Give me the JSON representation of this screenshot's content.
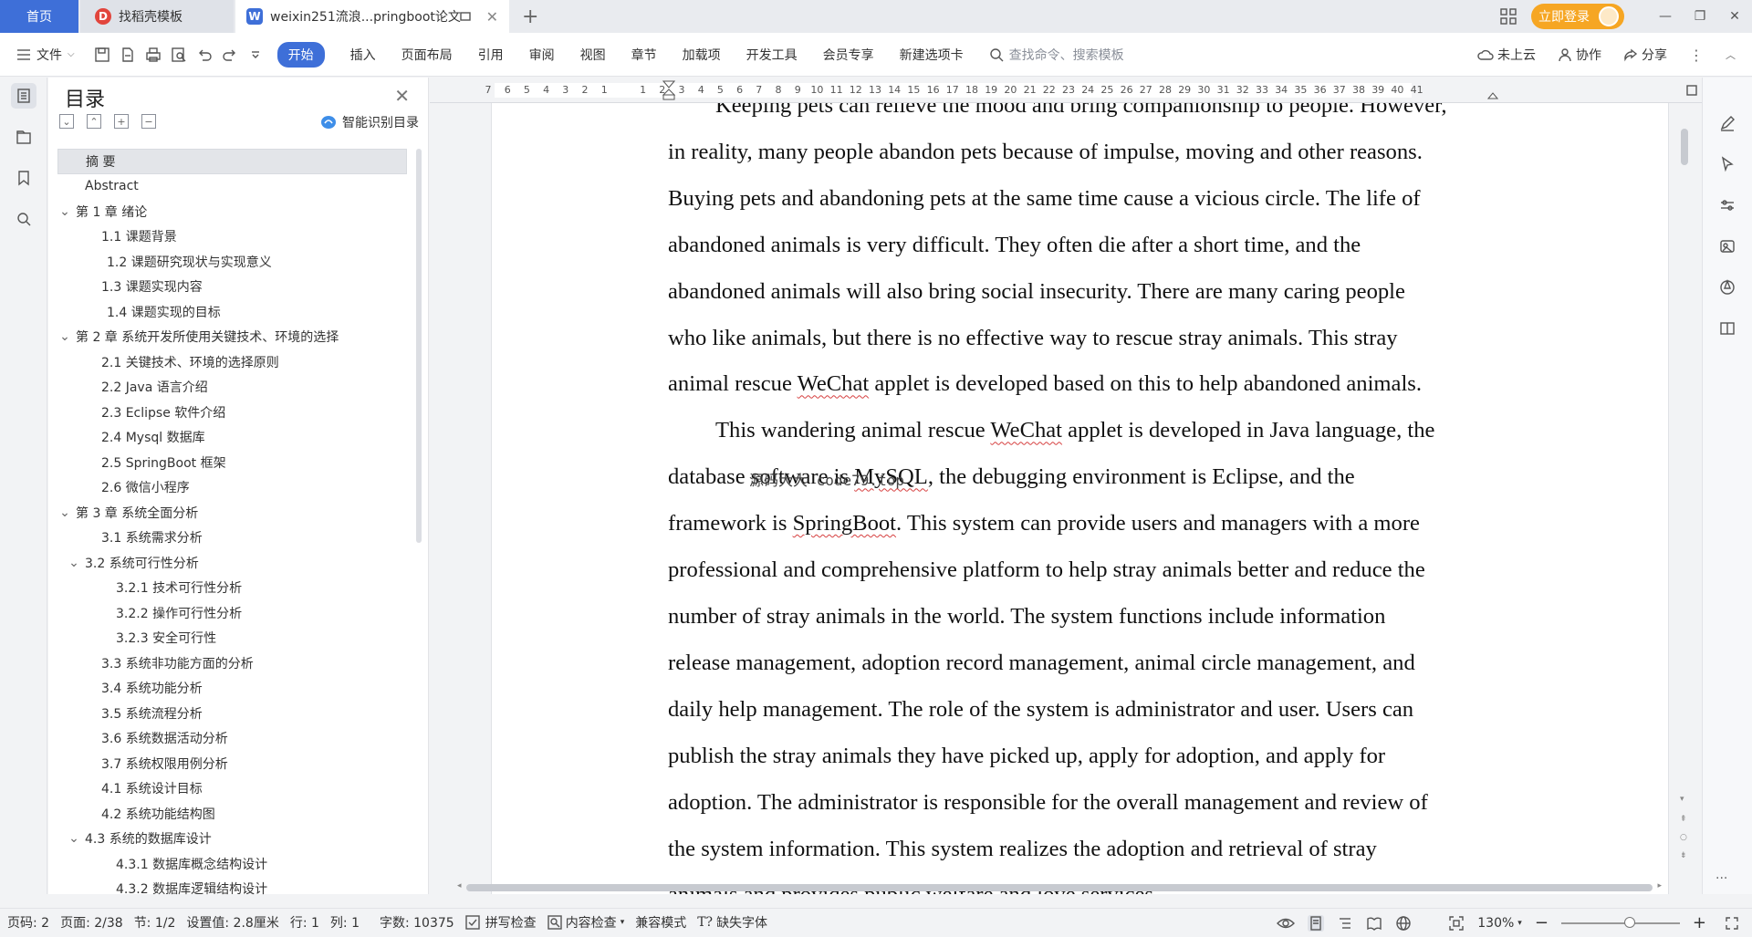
{
  "titlebar": {
    "tabs": [
      {
        "label": "首页"
      },
      {
        "label": "找稻壳模板"
      },
      {
        "label": "weixin251流浪...pringboot论文"
      }
    ],
    "login_label": "立即登录"
  },
  "ribbon": {
    "file_label": "文件",
    "tabs": [
      "开始",
      "插入",
      "页面布局",
      "引用",
      "审阅",
      "视图",
      "章节",
      "加载项",
      "开发工具",
      "会员专享",
      "新建选项卡"
    ],
    "search_placeholder": "查找命令、搜索模板",
    "right": {
      "cloud": "未上云",
      "collab": "协作",
      "share": "分享"
    }
  },
  "toc": {
    "title": "目录",
    "smart_label": "智能识别目录",
    "items": [
      {
        "label": "摘  要",
        "level": 1,
        "chevron": false,
        "selected": true
      },
      {
        "label": "Abstract",
        "level": 1,
        "chevron": false
      },
      {
        "label": "第 1 章  绪论",
        "level": 0,
        "chevron": true
      },
      {
        "label": "1.1 课题背景",
        "level": 2,
        "chevron": false
      },
      {
        "label": "1.2 课题研究现状与实现意义",
        "level": 2,
        "chevron": false,
        "extra": 1
      },
      {
        "label": "1.3 课题实现内容",
        "level": 2,
        "chevron": false
      },
      {
        "label": "1.4 课题实现的目标",
        "level": 2,
        "chevron": false,
        "extra": 1
      },
      {
        "label": "第 2 章  系统开发所使用关键技术、环境的选择",
        "level": 0,
        "chevron": true
      },
      {
        "label": "2.1 关键技术、环境的选择原则",
        "level": 2,
        "chevron": false
      },
      {
        "label": "2.2 Java 语言介绍",
        "level": 2,
        "chevron": false
      },
      {
        "label": "2.3 Eclipse 软件介绍",
        "level": 2,
        "chevron": false
      },
      {
        "label": "2.4 Mysql 数据库",
        "level": 2,
        "chevron": false
      },
      {
        "label": "2.5 SpringBoot 框架",
        "level": 2,
        "chevron": false
      },
      {
        "label": "2.6 微信小程序",
        "level": 2,
        "chevron": false
      },
      {
        "label": "第 3 章  系统全面分析",
        "level": 0,
        "chevron": true
      },
      {
        "label": "3.1 系统需求分析",
        "level": 2,
        "chevron": false
      },
      {
        "label": "3.2 系统可行性分析",
        "level": 1,
        "chevron": true
      },
      {
        "label": "3.2.1 技术可行性分析",
        "level": 3,
        "chevron": false
      },
      {
        "label": "3.2.2 操作可行性分析",
        "level": 3,
        "chevron": false
      },
      {
        "label": "3.2.3 安全可行性",
        "level": 3,
        "chevron": false
      },
      {
        "label": "3.3 系统非功能方面的分析",
        "level": 2,
        "chevron": false
      },
      {
        "label": "3.4 系统功能分析",
        "level": 2,
        "chevron": false
      },
      {
        "label": "3.5 系统流程分析",
        "level": 2,
        "chevron": false
      },
      {
        "label": "3.6 系统数据活动分析",
        "level": 2,
        "chevron": false
      },
      {
        "label": "3.7 系统权限用例分析",
        "level": 2,
        "chevron": false
      },
      {
        "label": "4.1 系统设计目标",
        "level": 2,
        "chevron": false
      },
      {
        "label": "4.2 系统功能结构图",
        "level": 2,
        "chevron": false
      },
      {
        "label": "4.3 系统的数据库设计",
        "level": 1,
        "chevron": true
      },
      {
        "label": "4.3.1 数据库概念结构设计",
        "level": 3,
        "chevron": false
      },
      {
        "label": "4.3.2 数据库逻辑结构设计",
        "level": 3,
        "chevron": false
      }
    ]
  },
  "ruler": {
    "labels": [
      "7",
      "6",
      "5",
      "4",
      "3",
      "2",
      "1",
      "",
      "1",
      "2",
      "3",
      "4",
      "5",
      "6",
      "7",
      "8",
      "9",
      "10",
      "11",
      "12",
      "13",
      "14",
      "15",
      "16",
      "17",
      "18",
      "19",
      "20",
      "21",
      "22",
      "23",
      "24",
      "25",
      "26",
      "27",
      "28",
      "29",
      "30",
      "31",
      "32",
      "33",
      "34",
      "35",
      "36",
      "37",
      "38",
      "39",
      "40",
      "41"
    ]
  },
  "document": {
    "lines": [
      {
        "segments": [
          {
            "text": "Keeping pets can relieve the mood and bring companionship to people. However,"
          }
        ],
        "indent": true
      },
      {
        "segments": [
          {
            "text": "in reality, many people abandon pets because of impulse, moving and other reasons."
          }
        ]
      },
      {
        "segments": [
          {
            "text": "Buying pets and abandoning pets at the same time cause a vicious circle. The life of"
          }
        ]
      },
      {
        "segments": [
          {
            "text": "abandoned animals is very difficult. They often die after a short time, and the"
          }
        ]
      },
      {
        "segments": [
          {
            "text": "abandoned animals will also bring social insecurity. There are many caring people"
          }
        ]
      },
      {
        "segments": [
          {
            "text": "who like animals, but there is no effective way to rescue stray animals. This stray"
          }
        ]
      },
      {
        "segments": [
          {
            "text": "animal rescue "
          },
          {
            "text": "WeChat",
            "squiggle": true
          },
          {
            "text": " applet is developed based on this to help abandoned animals."
          }
        ]
      },
      {
        "segments": [
          {
            "text": "This wandering animal rescue "
          },
          {
            "text": "WeChat",
            "squiggle": true
          },
          {
            "text": " applet is developed in Java language, the"
          }
        ],
        "indent": true
      },
      {
        "segments": [
          {
            "text": "database software is "
          },
          {
            "text": "MySQL",
            "squiggle": true
          },
          {
            "text": ", the debugging environment is Eclipse, and the"
          }
        ]
      },
      {
        "segments": [
          {
            "text": "framework is "
          },
          {
            "text": "SpringBoot",
            "squiggle": true
          },
          {
            "text": ". This system can provide users and managers with a more"
          }
        ]
      },
      {
        "segments": [
          {
            "text": "professional and comprehensive platform to help stray animals better and reduce the"
          }
        ]
      },
      {
        "segments": [
          {
            "text": "number of stray animals in the world. The system functions include information"
          }
        ]
      },
      {
        "segments": [
          {
            "text": "release management, adoption record management, animal circle management, and"
          }
        ]
      },
      {
        "segments": [
          {
            "text": "daily help management. The role of the system is administrator and user. Users can"
          }
        ]
      },
      {
        "segments": [
          {
            "text": "publish the stray animals they have picked up, apply for adoption, and apply for"
          }
        ]
      },
      {
        "segments": [
          {
            "text": "adoption. The administrator is responsible for the overall management and review of"
          }
        ]
      },
      {
        "segments": [
          {
            "text": "the system information. This system realizes the adoption and retrieval of stray"
          }
        ]
      },
      {
        "segments": [
          {
            "text": "animals and provides public welfare and love services."
          }
        ]
      }
    ],
    "watermark": "源码大大  code79.top"
  },
  "status": {
    "page_num": "页码: 2",
    "pages": "页面: 2/38",
    "section": "节: 1/2",
    "setting": "设置值: 2.8厘米",
    "row": "行: 1",
    "col": "列: 1",
    "word_count": "字数: 10375",
    "spell_check": "拼写检查",
    "content_check": "内容检查",
    "compat": "兼容模式",
    "missing_fonts": "缺失字体",
    "zoom": "130%",
    "zoom_level_fraction": 0.58
  }
}
